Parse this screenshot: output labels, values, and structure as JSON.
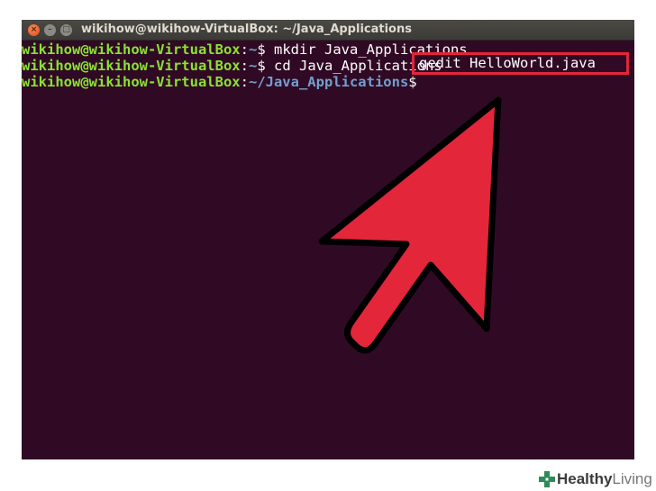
{
  "window": {
    "title": "wikihow@wikihow-VirtualBox: ~/Java_Applications",
    "buttons": {
      "close": "×",
      "minimize": "–",
      "maximize": "□"
    }
  },
  "terminal": {
    "lines": [
      {
        "user": "wikihow@wikihow-VirtualBox",
        "sep": ":",
        "path": "~",
        "prompt": "$ ",
        "command": "mkdir Java_Applications"
      },
      {
        "user": "wikihow@wikihow-VirtualBox",
        "sep": ":",
        "path": "~",
        "prompt": "$ ",
        "command": "cd Java_Applications"
      },
      {
        "user": "wikihow@wikihow-VirtualBox",
        "sep": ":",
        "path": "~/Java_Applications",
        "prompt": "$ ",
        "command": "gedit HelloWorld.java"
      }
    ],
    "background": "#300a24",
    "user_color": "#8ae234",
    "path_color": "#729fcf"
  },
  "annotation": {
    "highlight_color": "#e3263a",
    "arrow_icon": "red-arrow-icon"
  },
  "logo": {
    "bold": "Healthy",
    "light": "Living"
  }
}
